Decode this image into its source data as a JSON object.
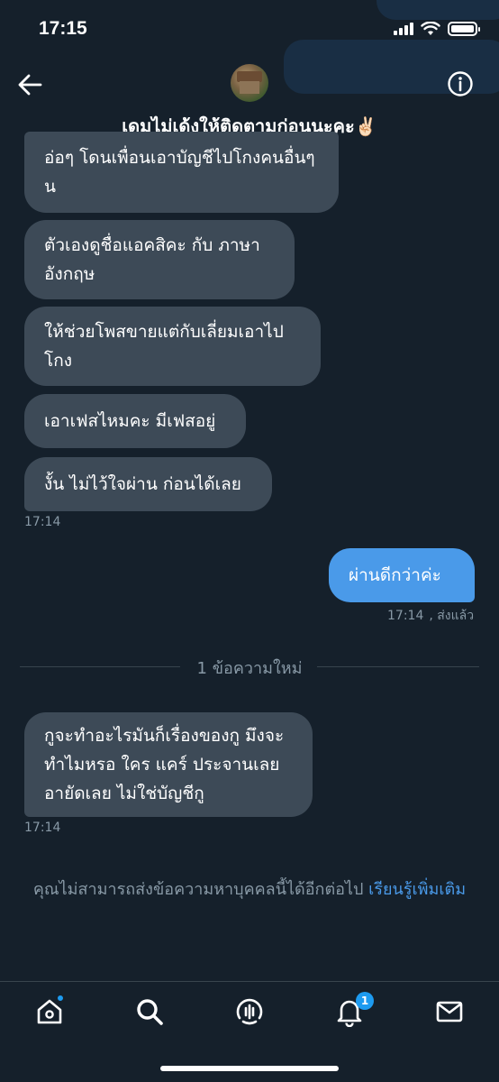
{
  "status_bar": {
    "time": "17:15"
  },
  "header": {
    "title": "เดมไม่เด้งให้ติดตามก่อนนะคะ✌🏻",
    "back_icon": "arrow-left-icon",
    "info_icon": "info-icon"
  },
  "messages": [
    {
      "direction": "in",
      "text_lines": [
        "อ่อๆ โดนเพื่อนเอาบัญชีไปโกงคนอื่นๆ",
        "น"
      ]
    },
    {
      "direction": "in",
      "text_lines": [
        "ตัวเองดูชื่อแอคสิคะ กับ ภาษา",
        "อังกฤษ"
      ]
    },
    {
      "direction": "in",
      "text_lines": [
        "ให้ช่วยโพสขายแต่กับเลี่ยมเอาไป",
        "โกง"
      ]
    },
    {
      "direction": "in",
      "text_lines": [
        "เอาเฟสไหมคะ มีเฟสอยู่"
      ]
    },
    {
      "direction": "in",
      "text_lines": [
        "งั้น ไม่ไว้ใจผ่าน ก่อนได้เลย"
      ],
      "timestamp": "17:14"
    },
    {
      "direction": "out",
      "text_lines": [
        "ผ่านดีกว่าค่ะ"
      ],
      "timestamp": "17:14",
      "status": ", ส่งแล้ว"
    },
    {
      "direction": "in",
      "text_lines": [
        "กูจะทำอะไรมันก็เรื่องของกู มึงจะ",
        "ทำไมหรอ ใคร แคร์ ประจานเลย",
        "อายัดเลย ไม่ใช่บัญชีกู"
      ],
      "timestamp": "17:14"
    }
  ],
  "divider": {
    "label": "1 ข้อความใหม่"
  },
  "notice": {
    "text": "คุณไม่สามารถส่งข้อความหาบุคคลนี้ได้อีกต่อไป ",
    "link": "เรียนรู้เพิ่มเติม"
  },
  "tab_bar": {
    "items": [
      {
        "icon": "home-icon",
        "has_dot": true
      },
      {
        "icon": "search-icon"
      },
      {
        "icon": "spaces-icon"
      },
      {
        "icon": "bell-icon",
        "badge": "1"
      },
      {
        "icon": "mail-icon"
      }
    ]
  },
  "colors": {
    "background": "#15202b",
    "incoming_bubble": "#3d4a57",
    "outgoing_bubble": "#4a9ae9",
    "muted_text": "#8899a6",
    "accent": "#1d9bf0"
  }
}
